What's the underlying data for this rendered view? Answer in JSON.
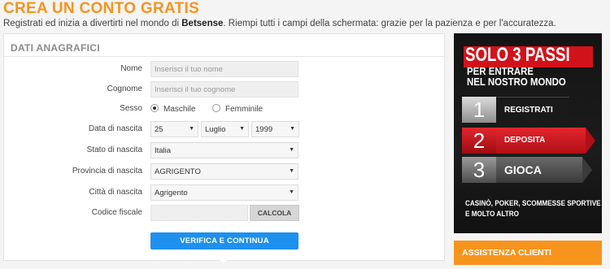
{
  "header": {
    "title": "CREA UN CONTO GRATIS",
    "subtitle_pre": "Registrati ed inizia a divertirti nel mondo di ",
    "subtitle_brand": "Betsense",
    "subtitle_post": ". Riempi tutti i campi della schermata: grazie per la pazienza e per l'accuratezza."
  },
  "form": {
    "section_title": "DATI ANAGRAFICI",
    "nome": {
      "label": "Nome",
      "placeholder": "Inserisci il tuo nome"
    },
    "cognome": {
      "label": "Cognome",
      "placeholder": "Inserisci il tuo cognome"
    },
    "sesso": {
      "label": "Sesso",
      "options": [
        "Maschile",
        "Femminile"
      ],
      "selected": "Maschile"
    },
    "data_nascita": {
      "label": "Data di nascita",
      "day": "25",
      "month": "Luglio",
      "year": "1999"
    },
    "stato_nascita": {
      "label": "Stato di nascita",
      "value": "Italia"
    },
    "provincia_nascita": {
      "label": "Provincia di nascita",
      "value": "AGRIGENTO"
    },
    "citta_nascita": {
      "label": "Città di nascita",
      "value": "Agrigento"
    },
    "codice_fiscale": {
      "label": "Codice fiscale",
      "value": "",
      "button": "CALCOLA"
    },
    "submit_label": "VERIFICA E CONTINUA"
  },
  "banner": {
    "title": "SOLO 3 PASSI",
    "line1": "PER ENTRARE",
    "line2": "NEL NOSTRO MONDO",
    "steps": [
      {
        "num": "1",
        "label": "REGISTRATI"
      },
      {
        "num": "2",
        "label": "DEPOSITA"
      },
      {
        "num": "3",
        "label": "GIOCA"
      }
    ],
    "footer1": "CASINÒ, POKER, SCOMMESSE SPORTIVE",
    "footer2": "E MOLTO ALTRO"
  },
  "assistenza": {
    "label": "ASSISTENZA CLIENTI"
  },
  "colors": {
    "accent_orange": "#f7941d",
    "button_blue": "#1e90ee",
    "banner_red": "#d2121b"
  }
}
